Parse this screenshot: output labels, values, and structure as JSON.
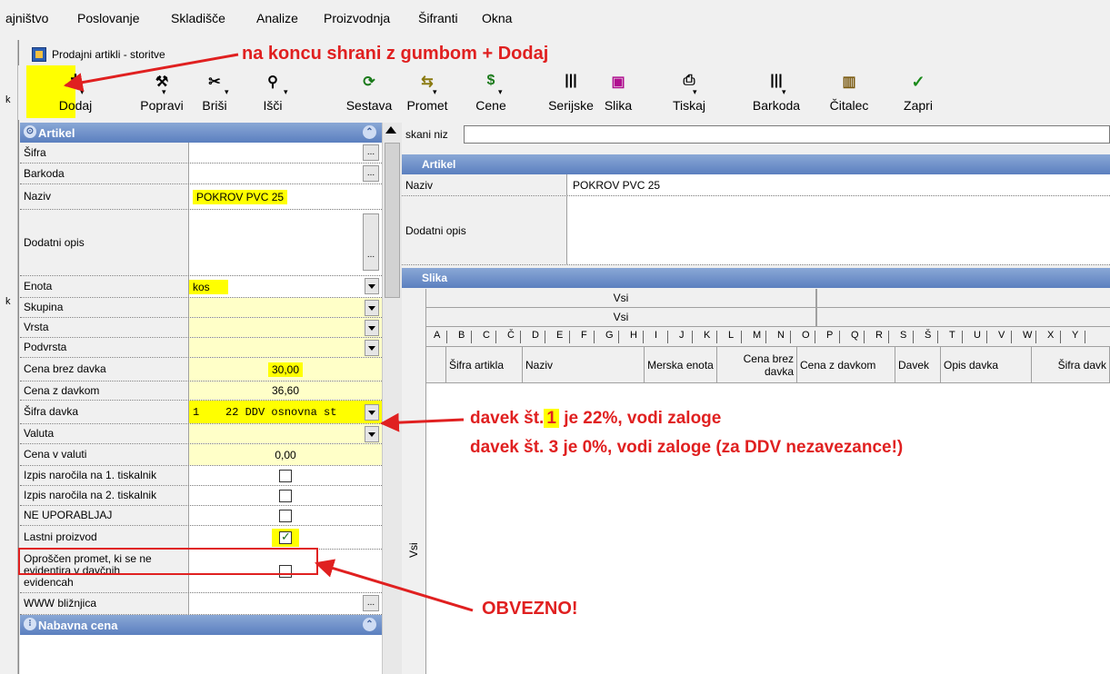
{
  "menu": {
    "items": [
      "ajništvo",
      "Poslovanje",
      "Skladišče",
      "Analize",
      "Proizvodnja",
      "Šifranti",
      "Okna"
    ]
  },
  "window": {
    "title": "Prodajni artikli - storitve"
  },
  "annotations": {
    "top": "na koncu shrani z gumbom + Dodaj",
    "davek_prefix": "davek št.",
    "davek_num": "1",
    "davek_suffix": "je 22%, vodi zaloge",
    "davek_line2": "davek št. 3 je 0%, vodi zaloge (za DDV nezavezance!)",
    "obvezno": "OBVEZNO!"
  },
  "toolbar": {
    "buttons": [
      {
        "label": "Dodaj",
        "icon": "+"
      },
      {
        "label": "Popravi",
        "icon": "⚒"
      },
      {
        "label": "Briši",
        "icon": "✂"
      },
      {
        "label": "Išči",
        "icon": "⚲"
      },
      {
        "label": "Sestava",
        "icon": "⟳"
      },
      {
        "label": "Promet",
        "icon": "⇆"
      },
      {
        "label": "Cene",
        "icon": "$"
      },
      {
        "label": "Serijske",
        "icon": "|||"
      },
      {
        "label": "Slika",
        "icon": "▣"
      },
      {
        "label": "Tiskaj",
        "icon": "⎙"
      },
      {
        "label": "Barkoda",
        "icon": "|||"
      },
      {
        "label": "Čitalec",
        "icon": "▥"
      },
      {
        "label": "Zapri",
        "icon": "✓"
      }
    ]
  },
  "left_panel": {
    "section_artikel": "Artikel",
    "section_nabavna": "Nabavna cena",
    "rows": {
      "sifra": {
        "label": "Šifra",
        "value": ""
      },
      "barkoda": {
        "label": "Barkoda",
        "value": ""
      },
      "naziv": {
        "label": "Naziv",
        "value": "POKROV PVC 25"
      },
      "dodatni_opis": {
        "label": "Dodatni opis",
        "value": ""
      },
      "enota": {
        "label": "Enota",
        "value": "kos"
      },
      "skupina": {
        "label": "Skupina",
        "value": ""
      },
      "vrsta": {
        "label": "Vrsta",
        "value": ""
      },
      "podvrsta": {
        "label": "Podvrsta",
        "value": ""
      },
      "cena_brez": {
        "label": "Cena brez davka",
        "value": "30,00"
      },
      "cena_z": {
        "label": "Cena z davkom",
        "value": "36,60"
      },
      "sifra_davka": {
        "label": "Šifra davka",
        "value": "1    22 DDV osnovna st"
      },
      "valuta": {
        "label": "Valuta",
        "value": ""
      },
      "cena_valuti": {
        "label": "Cena v valuti",
        "value": "0,00"
      },
      "izpis1": {
        "label": "Izpis naročila na 1. tiskalnik",
        "checked": false
      },
      "izpis2": {
        "label": "Izpis naročila na 2. tiskalnik",
        "checked": false
      },
      "ne_uporabljaj": {
        "label": "NE UPORABLJAJ",
        "checked": false
      },
      "lastni": {
        "label": "Lastni proizvod",
        "checked": true
      },
      "oproscen": {
        "label": "Oproščen promet, ki se ne evidentira v davčnih evidencah",
        "checked": false
      },
      "www": {
        "label": "WWW bližnjica",
        "value": ""
      }
    }
  },
  "right_panel": {
    "search_label": "skani niz",
    "search_value": "",
    "section_artikel": "Artikel",
    "naziv_label": "Naziv",
    "naziv_value": "POKROV PVC 25",
    "dodatni_label": "Dodatni opis",
    "section_slika": "Slika",
    "vsi1": "Vsi",
    "vsi2": "Vsi",
    "vsi_side": "Vsi",
    "letters": [
      "A",
      "B",
      "C",
      "Č",
      "D",
      "E",
      "F",
      "G",
      "H",
      "I",
      "J",
      "K",
      "L",
      "M",
      "N",
      "O",
      "P",
      "Q",
      "R",
      "S",
      "Š",
      "T",
      "U",
      "V",
      "W",
      "X",
      "Y"
    ],
    "columns": [
      "Šifra artikla",
      "Naziv",
      "Merska enota",
      "Cena brez davka",
      "Cena z davkom",
      "Davek",
      "Opis davka",
      "Šifra davk"
    ]
  },
  "strip": {
    "k1": "k",
    "k2": "k"
  }
}
